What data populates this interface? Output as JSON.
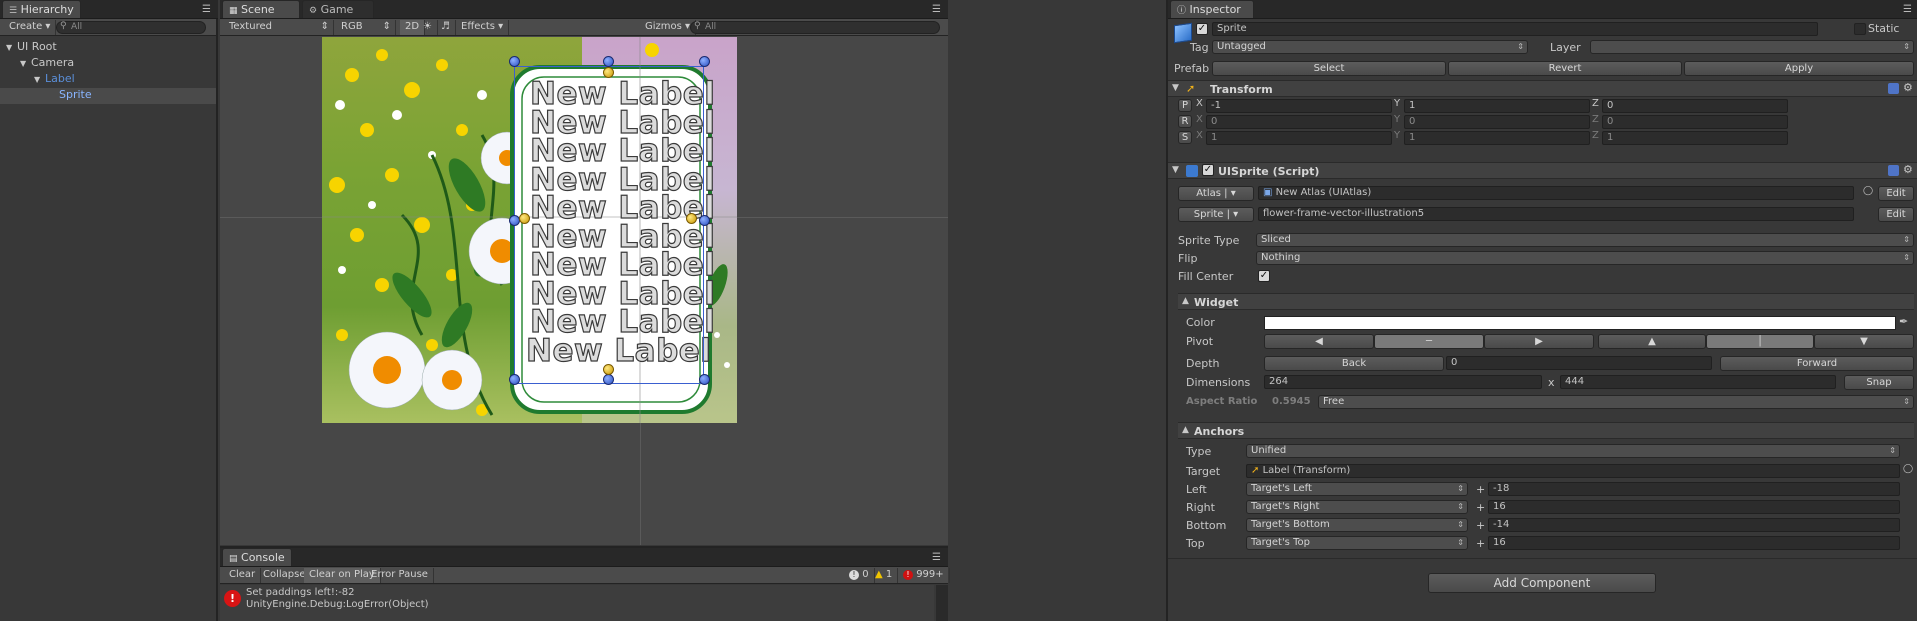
{
  "hierarchy": {
    "tab": "Hierarchy",
    "create_label": "Create",
    "search_placeholder": "All",
    "items": [
      {
        "label": "UI Root",
        "depth": 0,
        "arrow": "▼"
      },
      {
        "label": "Camera",
        "depth": 1,
        "arrow": "▼"
      },
      {
        "label": "Label",
        "depth": 2,
        "arrow": "▼"
      },
      {
        "label": "Sprite",
        "depth": 3,
        "arrow": ""
      }
    ]
  },
  "scene": {
    "tabs": [
      "Scene",
      "Game"
    ],
    "toolbar": {
      "draw_mode": "Textured",
      "render_mode": "RGB",
      "mode_2d": "2D",
      "effects": "Effects",
      "gizmos": "Gizmos",
      "search_placeholder": "All"
    },
    "labels": [
      "New Label",
      "New Label",
      "New Label",
      "New Label",
      "New Label",
      "New Label",
      "New Label",
      "New Label",
      "New Label",
      "New Label"
    ]
  },
  "console": {
    "tab": "Console",
    "buttons": [
      "Clear",
      "Collapse",
      "Clear on Play",
      "Error Pause"
    ],
    "counts": {
      "info": "0",
      "warn": "1",
      "error": "999+"
    },
    "entries": [
      {
        "line1": "Set paddings left!:-82",
        "line2": "UnityEngine.Debug:LogError(Object)"
      }
    ]
  },
  "inspector": {
    "tab": "Inspector",
    "object_name": "Sprite",
    "static_label": "Static",
    "tag_label": "Tag",
    "tag_value": "Untagged",
    "layer_label": "Layer",
    "layer_value": "",
    "prefab_label": "Prefab",
    "prefab_buttons": [
      "Select",
      "Revert",
      "Apply"
    ],
    "transform": {
      "title": "Transform",
      "rows": [
        {
          "key": "P",
          "x": "-1",
          "y": "1",
          "z": "0"
        },
        {
          "key": "R",
          "x": "0",
          "y": "0",
          "z": "0"
        },
        {
          "key": "S",
          "x": "1",
          "y": "1",
          "z": "1"
        }
      ],
      "axis": [
        "X",
        "Y",
        "Z"
      ]
    },
    "uisprite": {
      "title": "UISprite (Script)",
      "atlas_btn": "Atlas",
      "atlas_value": "New Atlas (UIAtlas)",
      "sprite_btn": "Sprite",
      "sprite_value": "flower-frame-vector-illustration5",
      "edit": "Edit",
      "sprite_type_label": "Sprite Type",
      "sprite_type": "Sliced",
      "flip_label": "Flip",
      "flip": "Nothing",
      "fill_center_label": "Fill Center"
    },
    "widget": {
      "title": "Widget",
      "color_label": "Color",
      "color": "#ffffff",
      "pivot_label": "Pivot",
      "depth_label": "Depth",
      "back": "Back",
      "depth": "0",
      "forward": "Forward",
      "dimensions_label": "Dimensions",
      "width": "264",
      "x_sep": "x",
      "height": "444",
      "snap": "Snap",
      "aspect_label": "Aspect Ratio",
      "aspect_value": "0.5945",
      "aspect_mode": "Free"
    },
    "anchors": {
      "title": "Anchors",
      "type_label": "Type",
      "type": "Unified",
      "target_label": "Target",
      "target": "Label (Transform)",
      "rows": [
        {
          "label": "Left",
          "ref": "Target's Left",
          "value": "-18"
        },
        {
          "label": "Right",
          "ref": "Target's Right",
          "value": "16"
        },
        {
          "label": "Bottom",
          "ref": "Target's Bottom",
          "value": "-14"
        },
        {
          "label": "Top",
          "ref": "Target's Top",
          "value": "16"
        }
      ]
    },
    "add_component": "Add Component"
  }
}
